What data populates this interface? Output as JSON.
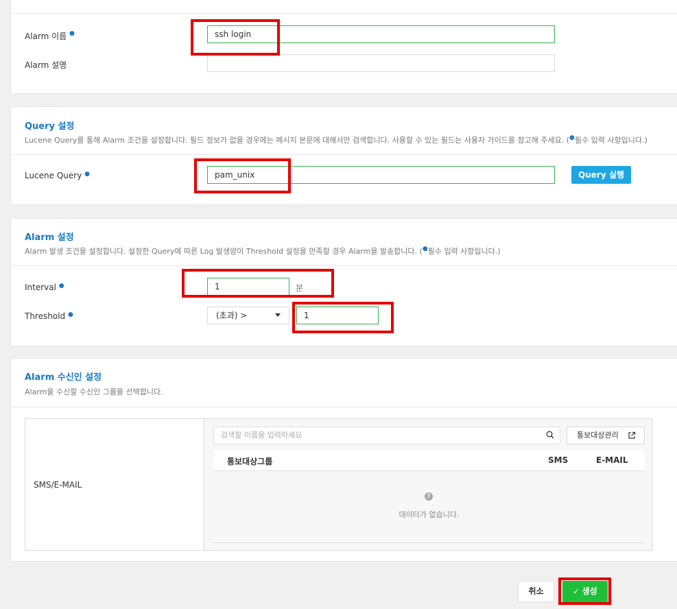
{
  "basic": {
    "alarm_name_label": "Alarm 이름",
    "alarm_name_value": "ssh login",
    "alarm_desc_label": "Alarm 설명",
    "alarm_desc_value": ""
  },
  "query": {
    "title": "Query 설정",
    "desc_before": "Lucene Query를 통해 Alarm 조건을 설정합니다. 필드 정보가 없을 경우에는 메시지 본문에 대해서만 검색합니다. 사용할 수 있는 필드는 사용자 가이드를 참고해 주세요. (",
    "desc_after": "필수 입력 사항입니다.)",
    "lucene_label": "Lucene Query",
    "lucene_value": "pam_unix",
    "run_button": "Query 실행"
  },
  "alarm": {
    "title": "Alarm 설정",
    "desc_before": "Alarm 발생 조건을 설정합니다. 설정한 Query에 따른 Log 발생양이 Threshold 설정을 만족할 경우 Alarm을 발송합니다. (",
    "desc_after": "필수 입력 사항입니다.)",
    "interval_label": "Interval",
    "interval_value": "1",
    "interval_unit": "분",
    "threshold_label": "Threshold",
    "threshold_operator": "(초과) >",
    "threshold_value": "1"
  },
  "recipients": {
    "title": "Alarm 수신인 설정",
    "desc": "Alarm을 수신할 수신인 그룹을 선택합니다.",
    "row_label": "SMS/E-MAIL",
    "search_placeholder": "검색할 이름을 입력하세요",
    "manage_button": "통보대상관리",
    "col_group": "통보대상그룹",
    "col_sms": "SMS",
    "col_email": "E-MAIL",
    "empty_text": "데이터가 없습니다."
  },
  "footer": {
    "cancel": "취소",
    "create": "생성"
  },
  "colors": {
    "accent": "#1a7ac5",
    "run_button": "#1ea6e3",
    "create_button": "#1fbf3a",
    "highlight": "#e60000"
  }
}
